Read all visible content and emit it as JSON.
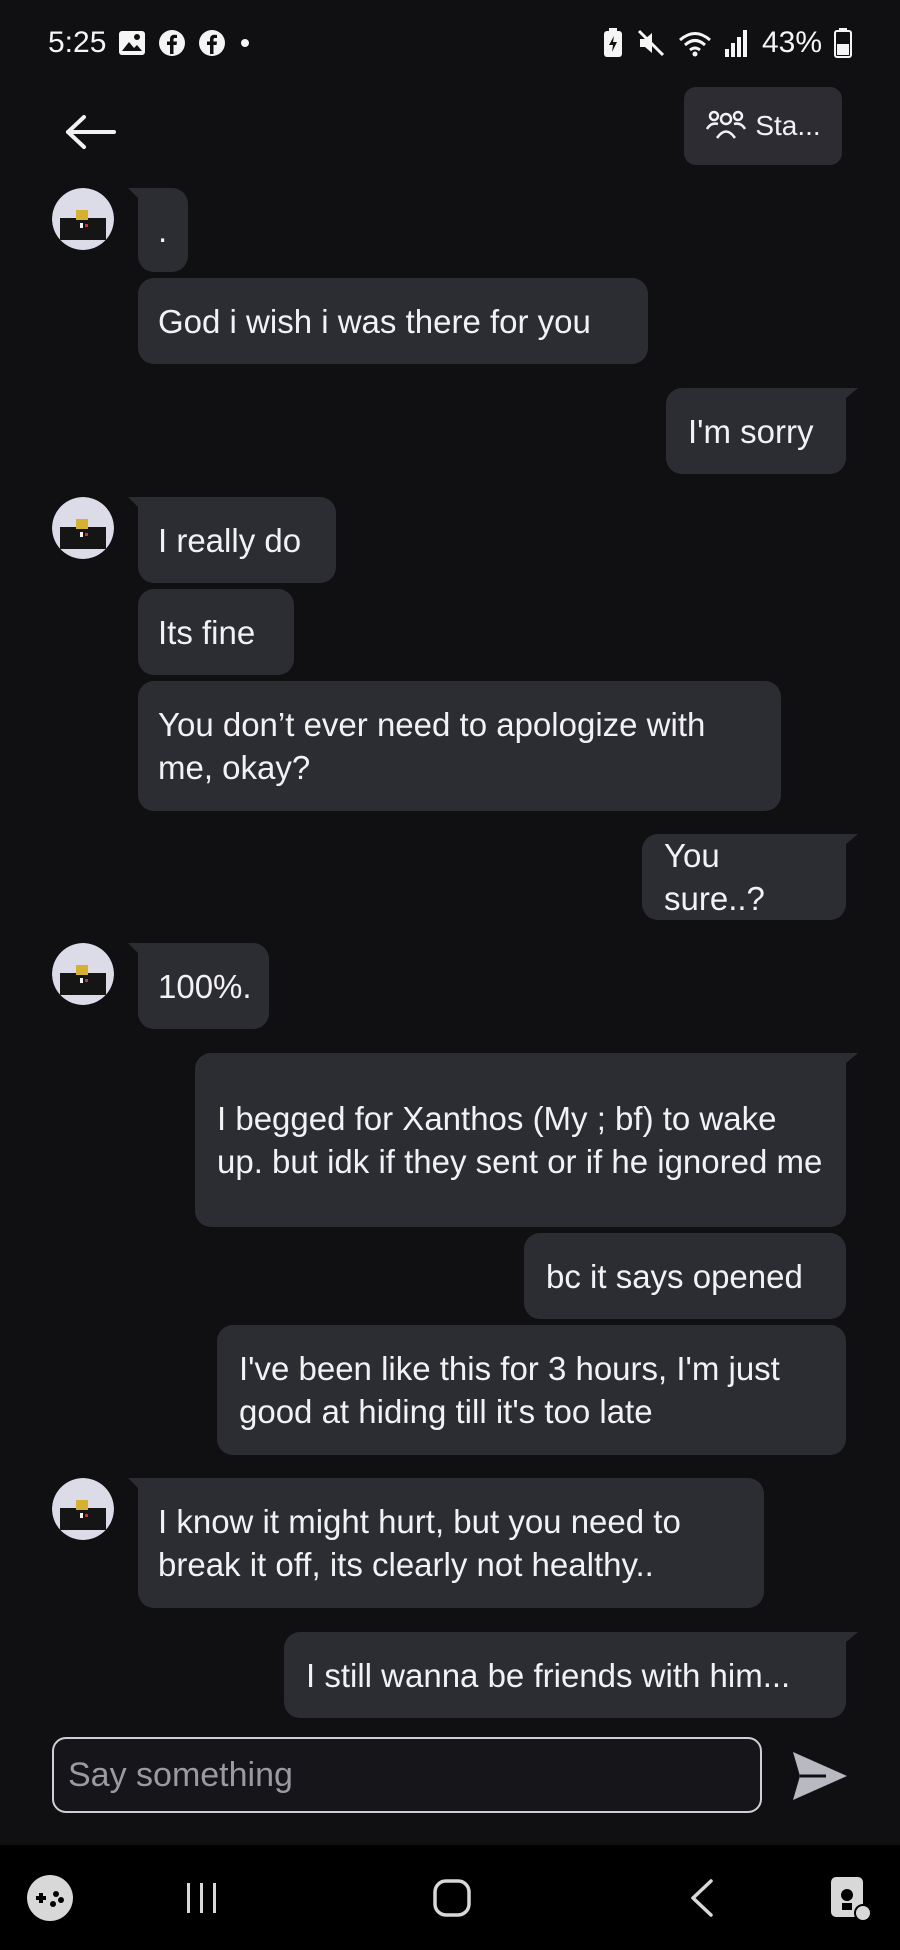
{
  "status_bar": {
    "time": "5:25",
    "battery": "43%",
    "left_icons": [
      "gallery-icon",
      "facebook-icon",
      "facebook-icon",
      "dot-icon"
    ],
    "right_icons": [
      "battery-saver-icon",
      "mute-icon",
      "wifi-6e-icon",
      "signal-icon",
      "battery-icon"
    ]
  },
  "header": {
    "back_icon": "arrow-left-icon",
    "status_button_label": "Sta..."
  },
  "messages": [
    {
      "side": "in",
      "text": "."
    },
    {
      "side": "in",
      "text": "God i wish i was there for you"
    },
    {
      "side": "out",
      "text": "I'm sorry"
    },
    {
      "side": "in",
      "text": "I really do"
    },
    {
      "side": "in",
      "text": "Its fine"
    },
    {
      "side": "in",
      "text": "You don’t ever need to apologize with me, okay?"
    },
    {
      "side": "out",
      "text": "You sure..?"
    },
    {
      "side": "in",
      "text": "100%."
    },
    {
      "side": "out",
      "text": "I begged for Xanthos (My ; bf) to wake up. but idk if they sent or if he ignored me"
    },
    {
      "side": "out",
      "text": "bc it says opened"
    },
    {
      "side": "out",
      "text": "I've been like this for 3 hours, I'm just good at hiding till it's too late"
    },
    {
      "side": "in",
      "text": "I know it might hurt, but you need to break it off, its clearly not healthy.."
    },
    {
      "side": "out",
      "text": "I still wanna be friends with him..."
    }
  ],
  "composer": {
    "placeholder": "Say something",
    "send_icon": "send-icon"
  },
  "nav_bar": {
    "items": [
      "game-launcher-icon",
      "recent-apps-icon",
      "home-icon",
      "back-icon",
      "assistant-icon"
    ]
  },
  "colors": {
    "background": "#101012",
    "bubble": "#2c2c33",
    "text": "#f2f2f4",
    "placeholder": "#9a9aa2"
  }
}
